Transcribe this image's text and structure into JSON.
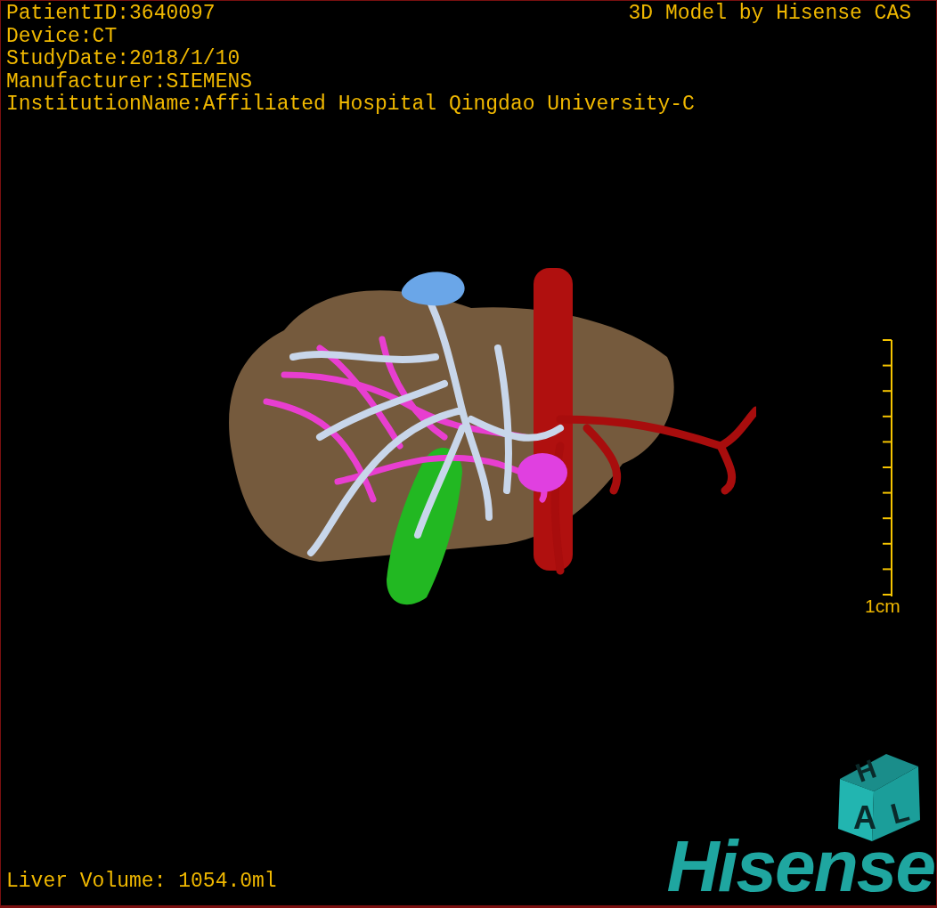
{
  "viewer": {
    "info_lines": [
      "PatientID:3640097",
      "Device:CT",
      "StudyDate:2018/1/10",
      "Manufacturer:SIEMENS",
      "InstitutionName:Affiliated Hospital Qingdao University-C"
    ],
    "caption": "3D Model by Hisense CAS",
    "scale_bar": {
      "label": "1cm"
    },
    "orientation_cube": {
      "faces": [
        "H",
        "A",
        "L"
      ]
    },
    "volume": "Liver Volume: 1054.0ml",
    "logo": "Hisense"
  }
}
